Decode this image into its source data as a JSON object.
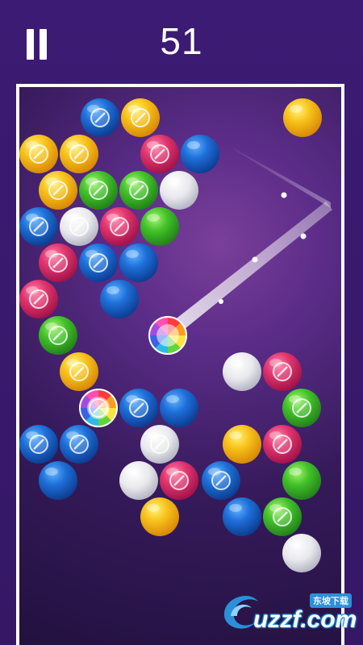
{
  "hud": {
    "score": "51",
    "pause_icon": "pause-icon"
  },
  "watermark": {
    "text": "uzzf.com",
    "subtext": "东坡下载"
  },
  "colors": {
    "background": "#3a1a72",
    "frame": "#ffffff",
    "blue": "#1e6fd9",
    "yellow": "#f7c21a",
    "pink": "#e0356e",
    "green": "#43c22a",
    "white": "#e9e9ee"
  },
  "launcher": {
    "type": "rainbow"
  },
  "next_bubble": {
    "color": "yellow"
  },
  "bubbles": [
    {
      "color": "blue",
      "marked": true
    },
    {
      "color": "yellow",
      "marked": true
    },
    {
      "color": "yellow",
      "marked": true
    },
    {
      "color": "yellow",
      "marked": true
    },
    {
      "color": "pink",
      "marked": true
    },
    {
      "color": "blue",
      "marked": false
    },
    {
      "color": "yellow",
      "marked": true
    },
    {
      "color": "green",
      "marked": true
    },
    {
      "color": "green",
      "marked": true
    },
    {
      "color": "white",
      "marked": false
    },
    {
      "color": "blue",
      "marked": true
    },
    {
      "color": "white",
      "marked": true
    },
    {
      "color": "pink",
      "marked": true
    },
    {
      "color": "green",
      "marked": false
    },
    {
      "color": "pink",
      "marked": true
    },
    {
      "color": "blue",
      "marked": true
    },
    {
      "color": "blue",
      "marked": false
    },
    {
      "color": "pink",
      "marked": true
    },
    {
      "color": "blue",
      "marked": false
    },
    {
      "color": "green",
      "marked": true
    },
    {
      "color": "yellow",
      "marked": true
    },
    {
      "color": "white",
      "marked": false
    },
    {
      "color": "pink",
      "marked": true
    },
    {
      "color": "rainbow",
      "marked": true
    },
    {
      "color": "blue",
      "marked": true
    },
    {
      "color": "blue",
      "marked": false
    },
    {
      "color": "green",
      "marked": true
    },
    {
      "color": "blue",
      "marked": true
    },
    {
      "color": "blue",
      "marked": true
    },
    {
      "color": "white",
      "marked": true
    },
    {
      "color": "yellow",
      "marked": false
    },
    {
      "color": "pink",
      "marked": true
    },
    {
      "color": "blue",
      "marked": false
    },
    {
      "color": "white",
      "marked": false
    },
    {
      "color": "pink",
      "marked": true
    },
    {
      "color": "blue",
      "marked": true
    },
    {
      "color": "green",
      "marked": false
    },
    {
      "color": "yellow",
      "marked": false
    },
    {
      "color": "blue",
      "marked": false
    },
    {
      "color": "green",
      "marked": true
    },
    {
      "color": "white",
      "marked": false
    }
  ]
}
